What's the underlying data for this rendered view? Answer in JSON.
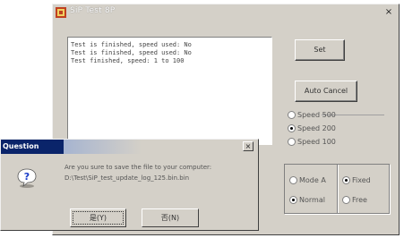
{
  "window": {
    "title": "SiP Test 8P",
    "close_glyph": "×"
  },
  "memo": {
    "lines": [
      "Test is finished, speed used: No",
      "Test is finished, speed used: No",
      "Test finished, speed: 1 to 100"
    ]
  },
  "buttons": {
    "set_label": "Set",
    "cancel_label": "Auto Cancel"
  },
  "speed_options": [
    {
      "label": "Speed 500",
      "selected": false
    },
    {
      "label": "Speed 200",
      "selected": true
    },
    {
      "label": "Speed 100",
      "selected": false
    }
  ],
  "mode_group": {
    "left": [
      {
        "label": "Mode A",
        "selected": false
      },
      {
        "label": "Normal",
        "selected": true
      }
    ],
    "right": [
      {
        "label": "Fixed",
        "selected": true
      },
      {
        "label": "Free",
        "selected": false
      }
    ]
  },
  "dialog": {
    "title": "Question",
    "close_glyph": "×",
    "message": "Are you sure to save the file to your computer: D:\\Test\\SiP_test_update_log_125.bin.bin",
    "yes_label": "是(Y)",
    "no_label": "否(N)"
  },
  "colors": {
    "dialog_title_bg": "#0a246a",
    "window_bg": "#d4d0c8"
  }
}
